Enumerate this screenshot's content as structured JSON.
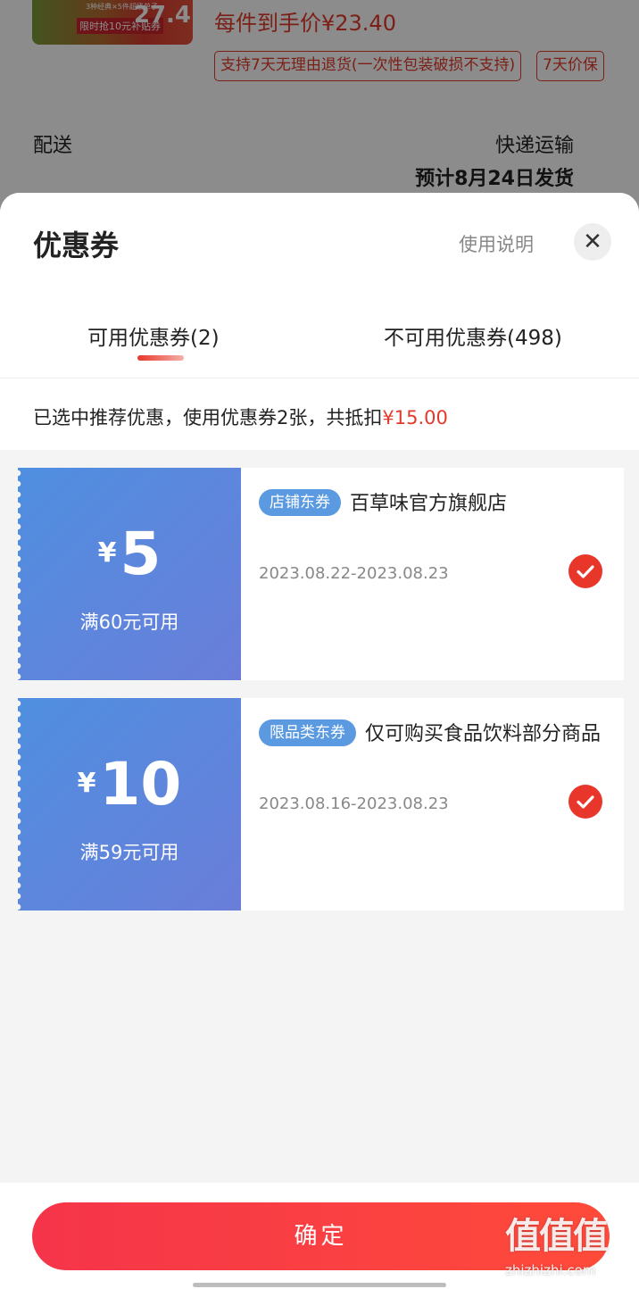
{
  "background": {
    "thumb": {
      "line1": "3种经典×5件超级单子",
      "line2": "限时抢10元补贴券",
      "price": "27.4"
    },
    "price_line": "每件到手价¥23.40",
    "tags": [
      "支持7天无理由退货(一次性包装破损不支持)",
      "7天价保"
    ],
    "shipping": {
      "label": "配送",
      "method": "快递运输",
      "estimate": "预计8月24日发货"
    }
  },
  "sheet": {
    "title": "优惠券",
    "usage_link": "使用说明",
    "close": "✕",
    "tabs": [
      {
        "label": "可用优惠券(2)",
        "active": true
      },
      {
        "label": "不可用优惠券(498)",
        "active": false
      }
    ],
    "summary": {
      "text": "已选中推荐优惠，使用优惠券2张，共抵扣",
      "amount": "¥15.00"
    },
    "coupons": [
      {
        "yen": "¥",
        "amount": "5",
        "condition": "满60元可用",
        "badge": "店铺东券",
        "title": "百草味官方旗舰店",
        "dates": "2023.08.22-2023.08.23",
        "selected": true
      },
      {
        "yen": "¥",
        "amount": "10",
        "condition": "满59元可用",
        "badge": "限品类东券",
        "title": "仅可购买食品饮料部分商品",
        "dates": "2023.08.16-2023.08.23",
        "selected": true
      }
    ]
  },
  "footer": {
    "confirm_label": "确定"
  },
  "watermark": {
    "mark": "值值值",
    "site": "zhizhizhi.com"
  },
  "colors": {
    "accent": "#e23a2b",
    "coupon_blue": "#5b8de0",
    "badge_blue": "#5b9ae0"
  }
}
